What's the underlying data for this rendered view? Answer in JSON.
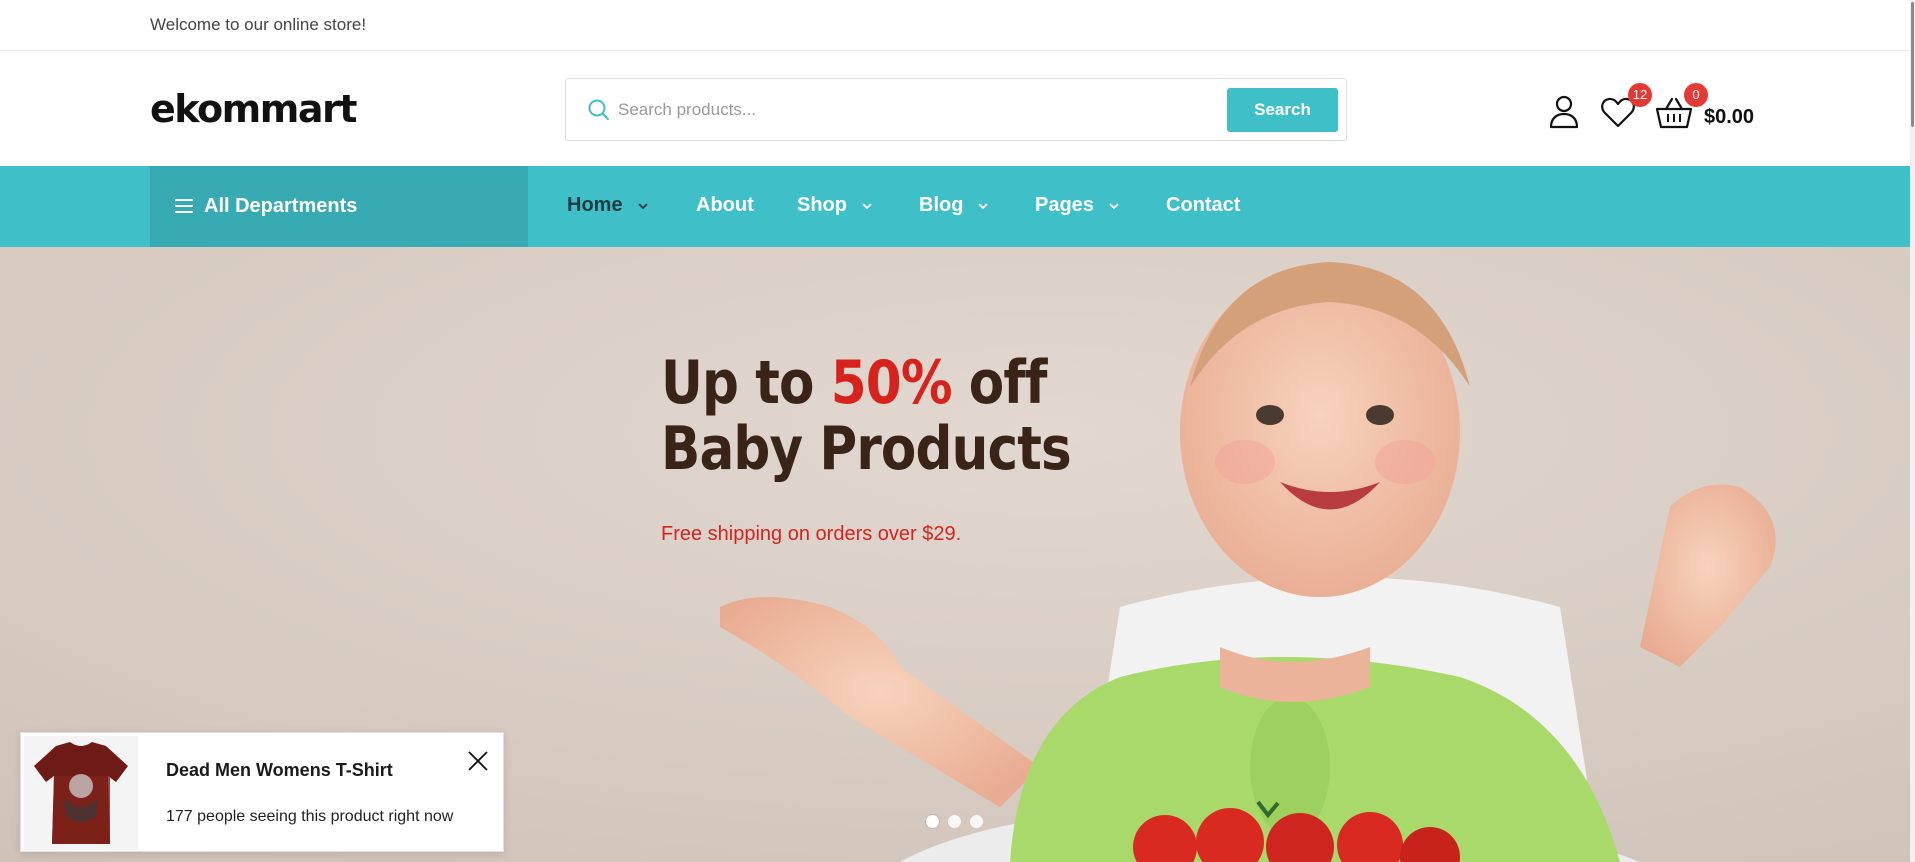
{
  "topbar": {
    "welcome": "Welcome to our online store!"
  },
  "header": {
    "logo": "ekommart",
    "search": {
      "placeholder": "Search products...",
      "button_label": "Search"
    },
    "icons": [
      "user-icon",
      "heart-icon",
      "cart-icon"
    ],
    "wishlist_count": "12",
    "cart_count": "0",
    "cart_total": "$0.00"
  },
  "nav": {
    "departments_label": "All Departments",
    "items": [
      {
        "label": "Home",
        "has_dropdown": true,
        "active": true
      },
      {
        "label": "About",
        "has_dropdown": false
      },
      {
        "label": "Shop",
        "has_dropdown": true
      },
      {
        "label": "Blog",
        "has_dropdown": true
      },
      {
        "label": "Pages",
        "has_dropdown": true
      },
      {
        "label": "Contact",
        "has_dropdown": false
      }
    ]
  },
  "hero": {
    "line1_prefix": "Up to ",
    "line1_highlight": "50%",
    "line1_suffix": " off",
    "line2": "Baby Products",
    "subtitle": "Free shipping on orders over $29.",
    "slides": 3,
    "active_slide": 1
  },
  "popup": {
    "product_name": "Dead Men Womens T-Shirt",
    "message": "177 people seeing this product right now"
  },
  "colors": {
    "accent": "#3fbfc8",
    "accent_dark": "#37aab3",
    "sale_red": "#d6231e",
    "badge_red": "#e53935",
    "hero_text": "#3a2418"
  }
}
